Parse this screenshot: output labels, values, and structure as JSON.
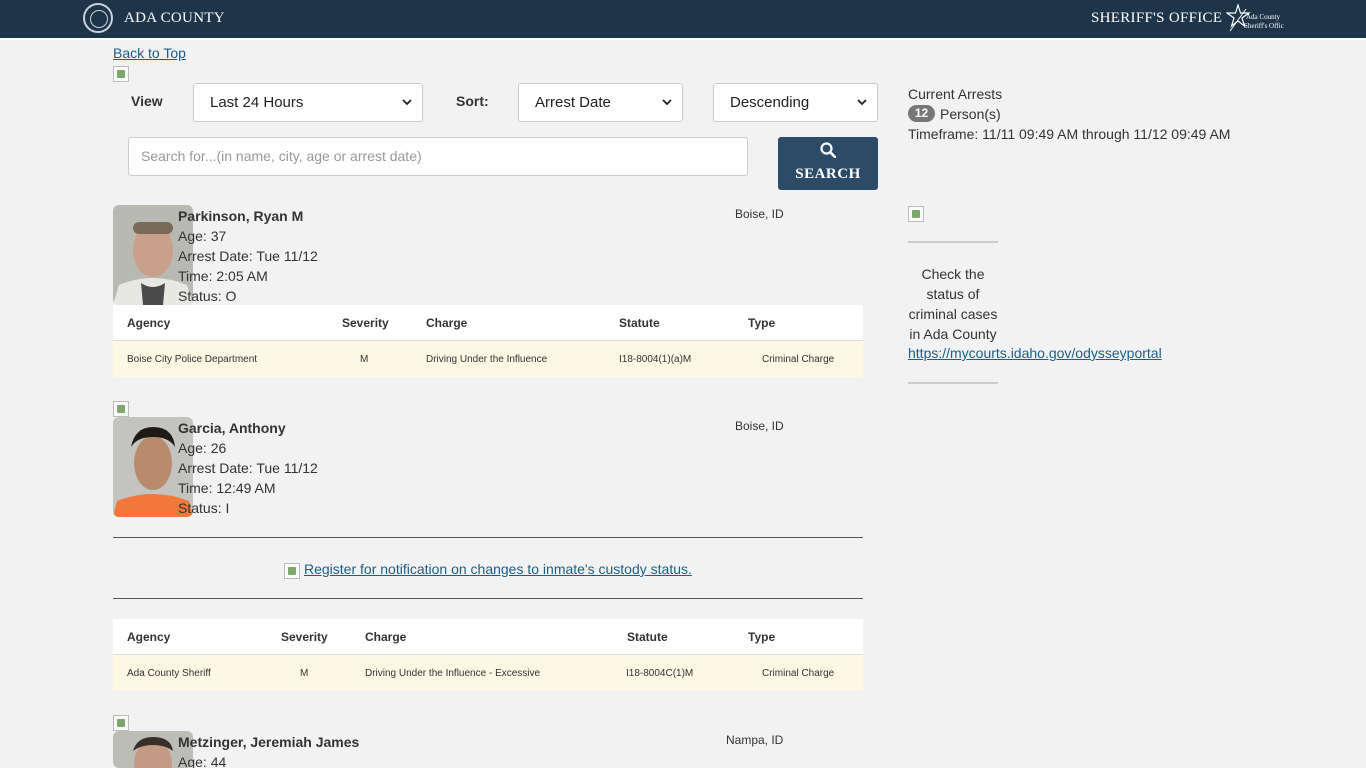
{
  "header": {
    "brand": "ADA COUNTY",
    "office": "SHERIFF'S OFFICE",
    "logo_text": "Ada County Sheriff's Office"
  },
  "nav": {
    "back_to_top": "Back to Top"
  },
  "filters": {
    "view_label": "View",
    "view_value": "Last 24 Hours",
    "sort_label": "Sort:",
    "sort_value": "Arrest Date",
    "order_value": "Descending",
    "search_placeholder": "Search for...(in name, city, age or arrest date)",
    "search_button": "SEARCH"
  },
  "table_headers": {
    "agency": "Agency",
    "severity": "Severity",
    "charge": "Charge",
    "statute": "Statute",
    "type": "Type"
  },
  "inmates": [
    {
      "name": "Parkinson, Ryan M",
      "age": "Age: 37",
      "arrest_date": "Arrest Date: Tue 11/12",
      "time": "Time: 2:05 AM",
      "status": "Status: O",
      "city": "Boise, ID",
      "charges": [
        {
          "agency": "Boise City Police Department",
          "severity": "M",
          "charge": "Driving Under the Influence",
          "statute": "I18-8004(1)(a)M",
          "type": "Criminal Charge"
        }
      ]
    },
    {
      "name": "Garcia, Anthony",
      "age": "Age: 26",
      "arrest_date": "Arrest Date: Tue 11/12",
      "time": "Time: 12:49 AM",
      "status": "Status: I",
      "city": "Boise, ID",
      "notify_link": "Register for notification on changes to inmate's custody status.",
      "charges": [
        {
          "agency": "Ada County Sheriff",
          "severity": "M",
          "charge": "Driving Under the Influence - Excessive",
          "statute": "I18-8004C(1)M",
          "type": "Criminal Charge"
        }
      ]
    },
    {
      "name": "Metzinger, Jeremiah James",
      "age": "Age: 44",
      "city": "Nampa, ID"
    }
  ],
  "sidebar": {
    "current_arrests": "Current Arrests",
    "count": "12",
    "persons": "Person(s)",
    "timeframe": "Timeframe: 11/11 09:49 AM through 11/12 09:49 AM",
    "check_line1": "Check the",
    "check_line2": "status of",
    "check_line3": "criminal cases",
    "check_line4": "in Ada County",
    "portal_link": "https://mycourts.idaho.gov/odysseyportal"
  },
  "colors": {
    "header_bg": "#1d3449",
    "button_bg": "#2c4b66",
    "row_highlight": "#fdf8e3",
    "link": "#1b5e8a"
  }
}
